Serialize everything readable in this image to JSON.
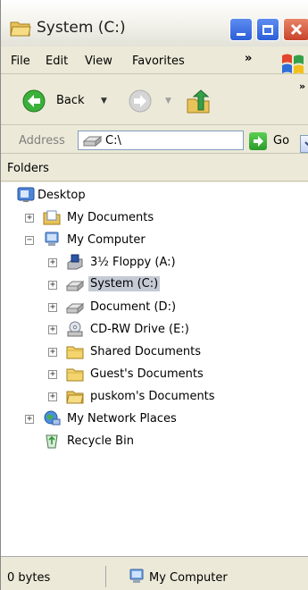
{
  "window": {
    "title": "System (C:)"
  },
  "menu": {
    "file": "File",
    "edit": "Edit",
    "view": "View",
    "favorites": "Favorites",
    "more": "»"
  },
  "toolbar": {
    "back_label": "Back",
    "more": "»"
  },
  "address": {
    "label": "Address",
    "value": "C:\\",
    "go_label": "Go"
  },
  "folders_header": "Folders",
  "tree": {
    "desktop": "Desktop",
    "my_documents": "My Documents",
    "my_computer": "My Computer",
    "floppy": "3½ Floppy (A:)",
    "system_c": "System (C:)",
    "document_d": "Document (D:)",
    "cdrw_e": "CD-RW Drive (E:)",
    "shared_docs": "Shared Documents",
    "guest_docs": "Guest's Documents",
    "puskom_docs": "puskom's Documents",
    "network_places": "My Network Places",
    "recycle_bin": "Recycle Bin"
  },
  "status": {
    "size": "0 bytes",
    "location": "My Computer"
  },
  "colors": {
    "selection": "#c5cad5",
    "chrome": "#ece9d8",
    "close_button": "#c8432a"
  }
}
